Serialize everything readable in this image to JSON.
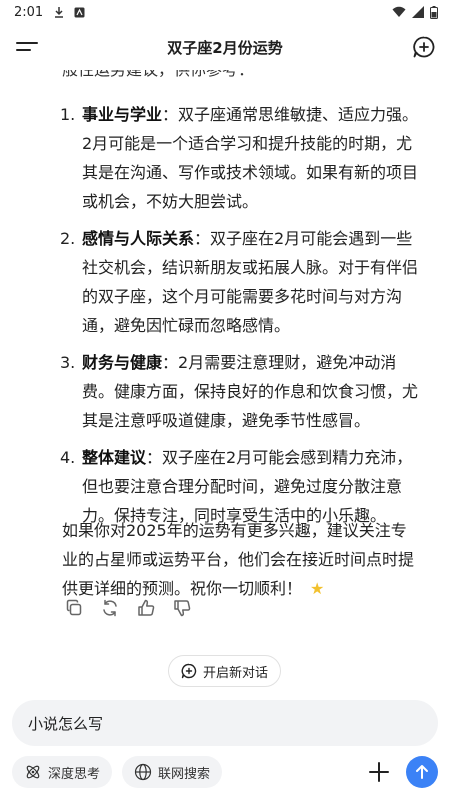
{
  "status_bar": {
    "time": "2:01"
  },
  "header": {
    "title": "双子座2月份运势"
  },
  "content": {
    "cut_line": "般性运势建议，供你参考：",
    "items": [
      {
        "num": "1.",
        "title": "事业与学业",
        "sep": "：",
        "text": "双子座通常思维敏捷、适应力强。2月可能是一个适合学习和提升技能的时期，尤其是在沟通、写作或技术领域。如果有新的项目或机会，不妨大胆尝试。"
      },
      {
        "num": "2.",
        "title": "感情与人际关系",
        "sep": "：",
        "text": "双子座在2月可能会遇到一些社交机会，结识新朋友或拓展人脉。对于有伴侣的双子座，这个月可能需要多花时间与对方沟通，避免因忙碌而忽略感情。"
      },
      {
        "num": "3.",
        "title": "财务与健康",
        "sep": "：",
        "text": "2月需要注意理财，避免冲动消费。健康方面，保持良好的作息和饮食习惯，尤其是注意呼吸道健康，避免季节性感冒。"
      },
      {
        "num": "4.",
        "title": "整体建议",
        "sep": "：",
        "text": "双子座在2月可能会感到精力充沛，但也要注意合理分配时间，避免过度分散注意力。保持专注，同时享受生活中的小乐趣。"
      }
    ],
    "closing": "如果你对2025年的运势有更多兴趣，建议关注专业的占星师或运势平台，他们会在接近时间点时提供更详细的预测。祝你一切顺利！",
    "closing_emoji": "★"
  },
  "new_conversation": {
    "label": "开启新对话"
  },
  "input": {
    "value": "小说怎么写"
  },
  "bottom": {
    "deep_think": "深度思考",
    "web_search": "联网搜索"
  }
}
